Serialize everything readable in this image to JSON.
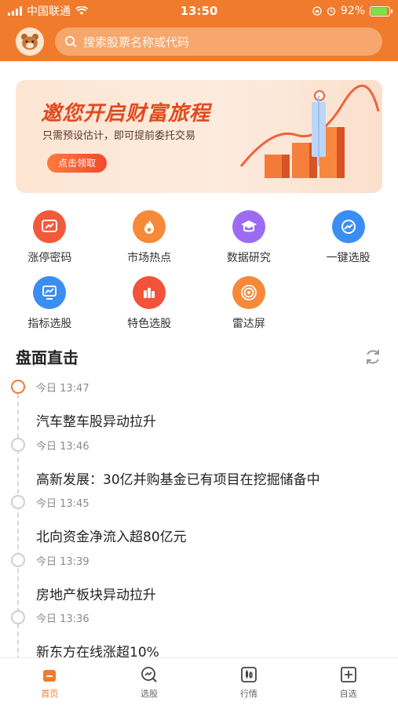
{
  "status_bar": {
    "carrier": "中国联通",
    "time": "13:50",
    "battery": "92%",
    "battery_level": 0.92
  },
  "header": {
    "search_placeholder": "搜索股票名称或代码"
  },
  "banner": {
    "title": "邀您开启财富旅程",
    "subtitle": "只需预设估计，即可提前委托交易",
    "cta": "点击领取"
  },
  "features": [
    {
      "label": "涨停密码",
      "icon": "chart-up-icon",
      "color": "#f25a3a"
    },
    {
      "label": "市场热点",
      "icon": "flame-icon",
      "color": "#f7893a"
    },
    {
      "label": "数据研究",
      "icon": "graduation-cap-icon",
      "color": "#9b6cf2"
    },
    {
      "label": "一键选股",
      "icon": "trend-circle-icon",
      "color": "#3a8ef2"
    },
    {
      "label": "指标选股",
      "icon": "monitor-chart-icon",
      "color": "#3a8ef2"
    },
    {
      "label": "特色选股",
      "icon": "bars-icon",
      "color": "#f2533a"
    },
    {
      "label": "雷达屏",
      "icon": "radar-icon",
      "color": "#f7893a"
    }
  ],
  "section": {
    "title": "盘面直击"
  },
  "timeline": [
    {
      "time": "今日 13:47",
      "text": "汽车整车股异动拉升",
      "active": true
    },
    {
      "time": "今日 13:46",
      "text": "高新发展：30亿并购基金已有项目在挖掘储备中",
      "active": false
    },
    {
      "time": "今日 13:45",
      "text": "北向资金净流入超80亿元",
      "active": false
    },
    {
      "time": "今日 13:39",
      "text": "房地产板块异动拉升",
      "active": false
    },
    {
      "time": "今日 13:36",
      "text": "新东方在线涨超10%",
      "active": false
    }
  ],
  "tabbar": [
    {
      "label": "首页",
      "icon": "home-icon",
      "active": true
    },
    {
      "label": "选股",
      "icon": "stock-pick-icon",
      "active": false
    },
    {
      "label": "行情",
      "icon": "candlestick-icon",
      "active": false
    },
    {
      "label": "自选",
      "icon": "add-square-icon",
      "active": false
    }
  ],
  "colors": {
    "brand": "#f07b2c",
    "accent_red": "#e14a1f"
  }
}
